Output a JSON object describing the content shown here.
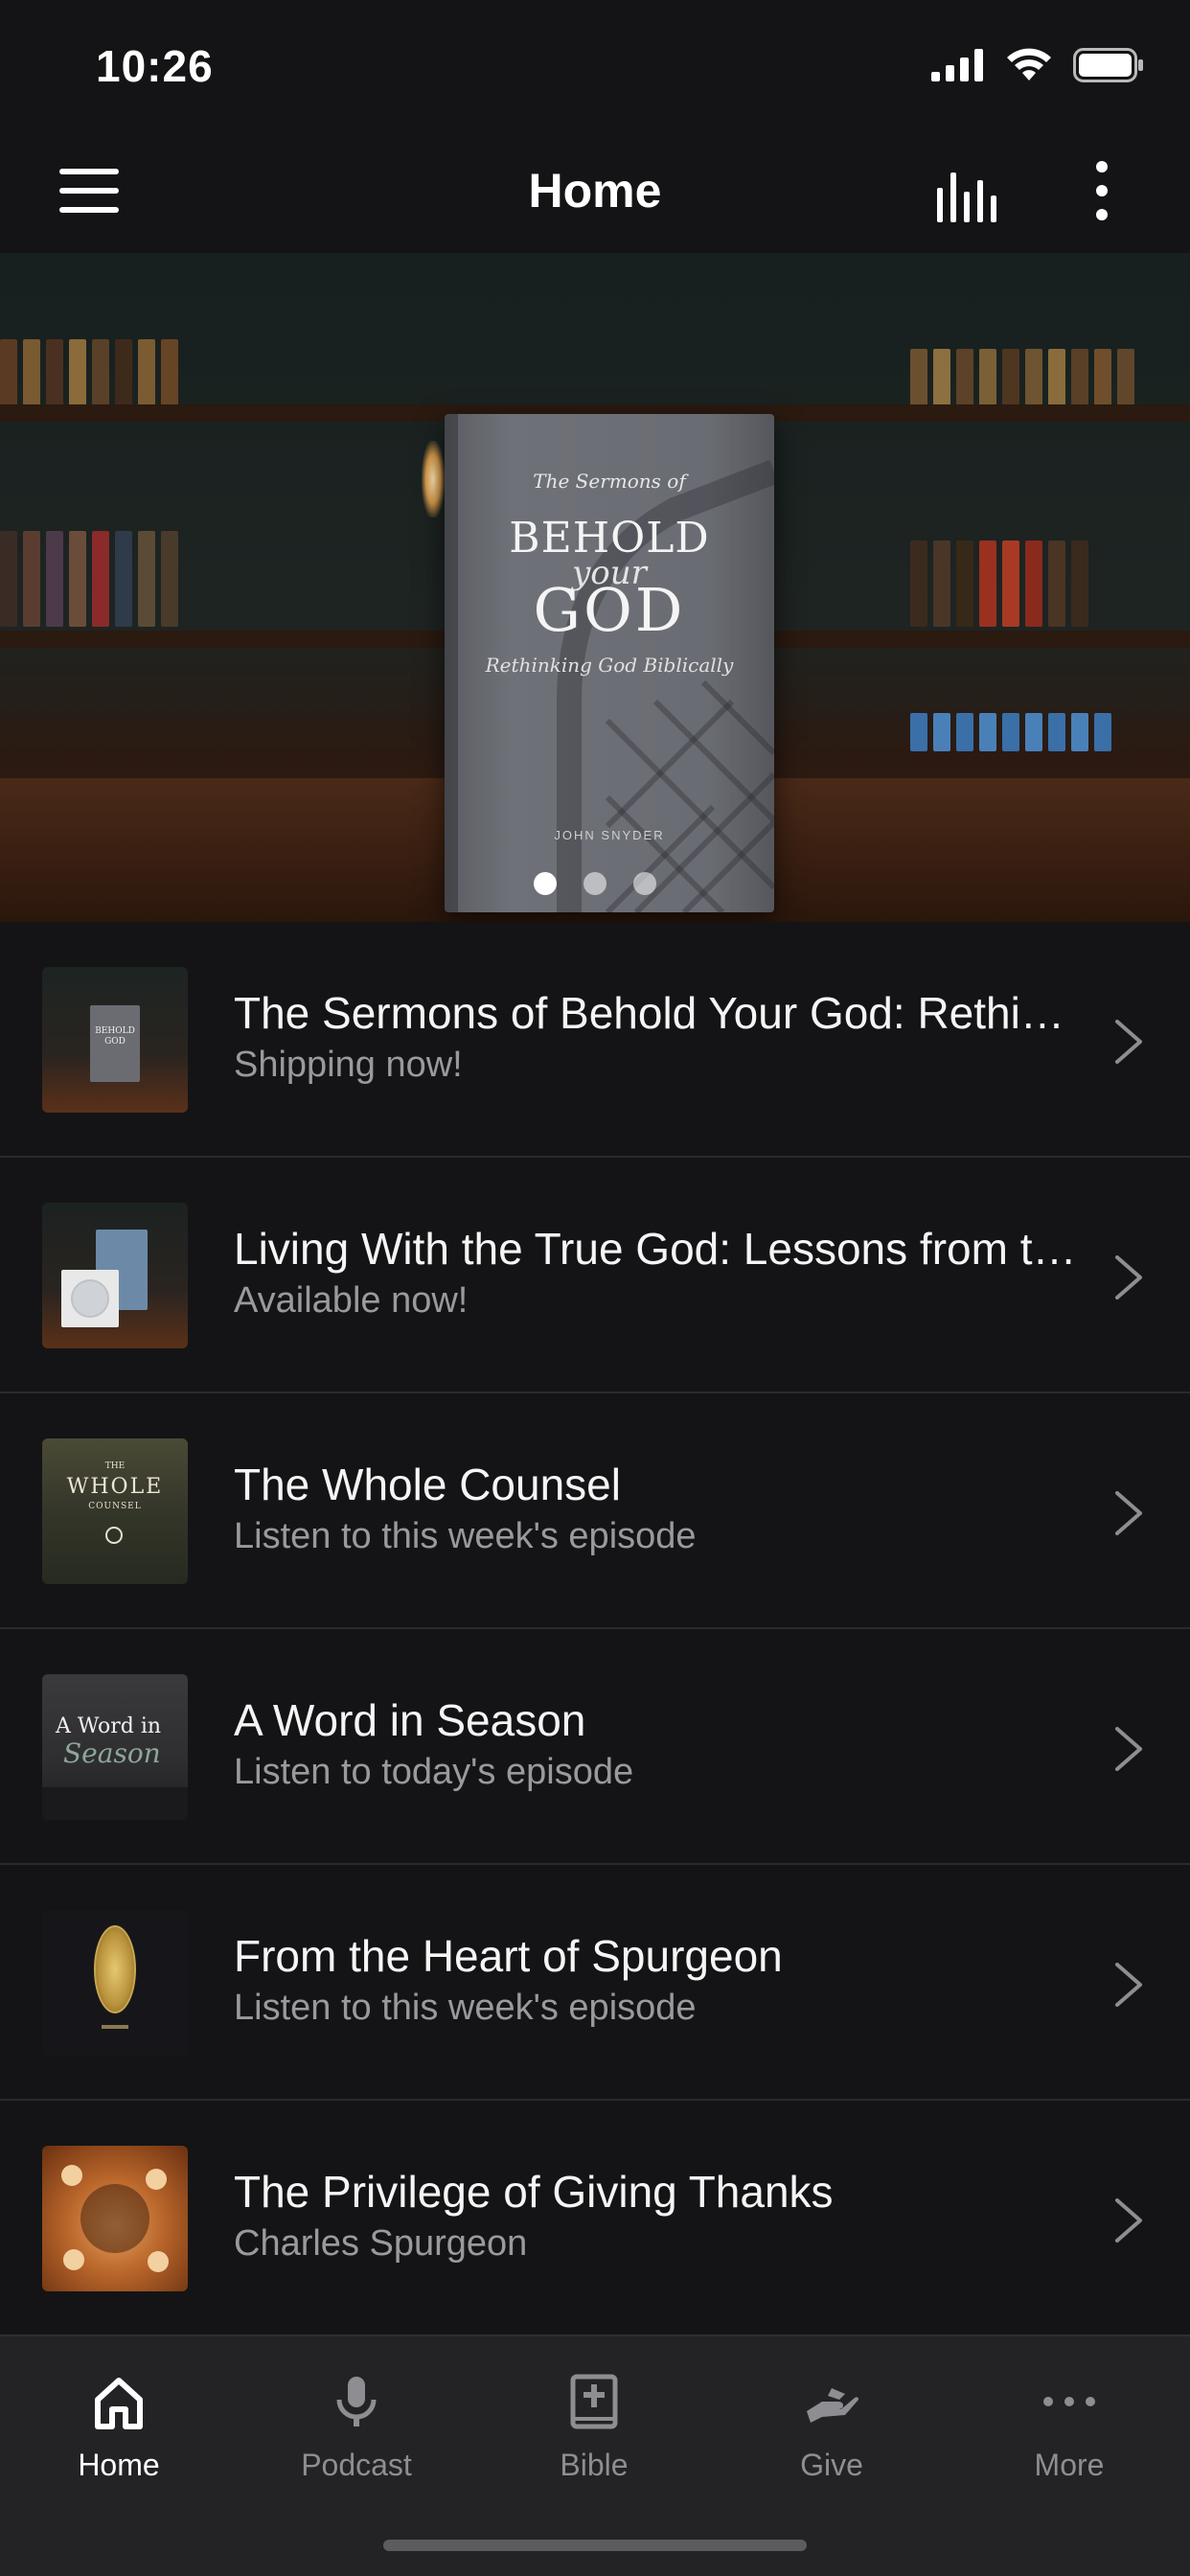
{
  "status_bar": {
    "time": "10:26"
  },
  "nav": {
    "title": "Home",
    "menu_icon": "hamburger-menu-icon",
    "stats_icon": "audio-bars-icon",
    "more_icon": "vertical-ellipsis-icon"
  },
  "hero": {
    "book_subtitle": "The Sermons of",
    "book_title_line1": "BEHOLD",
    "book_title_line2": "your",
    "book_title_line3": "GOD",
    "book_tagline": "Rethinking God Biblically",
    "book_author": "JOHN SNYDER",
    "carousel_pages": 3,
    "carousel_active_index": 0
  },
  "items": [
    {
      "title": "The Sermons of Behold Your God: Rethinking God Biblically",
      "subtitle": "Shipping now!"
    },
    {
      "title": "Living With the True God: Lessons from the Life of Jacob",
      "subtitle": "Available now!"
    },
    {
      "title": "The Whole Counsel",
      "subtitle": "Listen to this week's episode"
    },
    {
      "title": "A Word in Season",
      "subtitle": "Listen to today's episode"
    },
    {
      "title": "From the Heart of Spurgeon",
      "subtitle": "Listen to this week's episode"
    },
    {
      "title": "The Privilege of Giving Thanks",
      "subtitle": "Charles Spurgeon"
    }
  ],
  "thumbs": {
    "whole_counsel": {
      "line1": "THE",
      "line2": "WHOLE",
      "line3": "COUNSEL"
    },
    "word_in_season": {
      "line1": "A Word in",
      "line2": "Season"
    }
  },
  "tabs": [
    {
      "label": "Home",
      "icon": "home-icon",
      "active": true
    },
    {
      "label": "Podcast",
      "icon": "microphone-icon",
      "active": false
    },
    {
      "label": "Bible",
      "icon": "bible-icon",
      "active": false
    },
    {
      "label": "Give",
      "icon": "giving-hand-icon",
      "active": false
    },
    {
      "label": "More",
      "icon": "horizontal-ellipsis-icon",
      "active": false
    }
  ],
  "colors": {
    "background": "#141416",
    "tab_bar": "#232326",
    "text_primary": "#f5f5f5",
    "text_secondary": "#9a9a9d",
    "divider": "#2a2a2d"
  }
}
